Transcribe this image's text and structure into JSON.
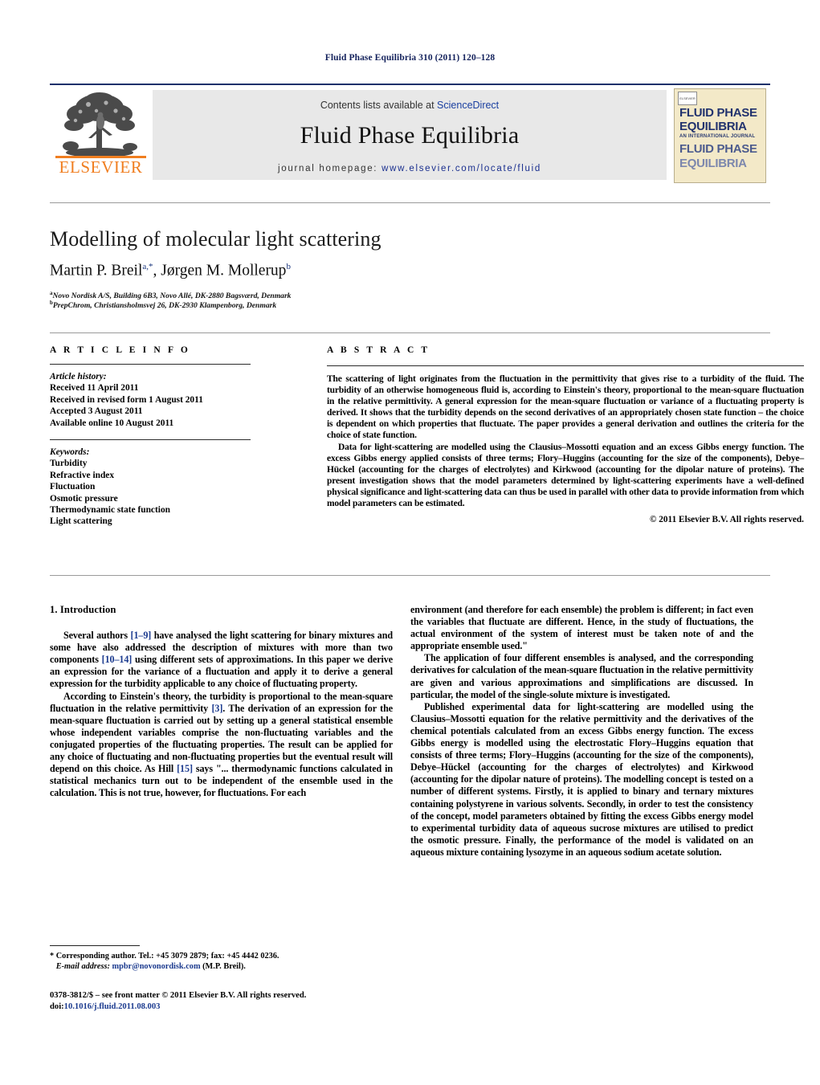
{
  "running_head": "Fluid Phase Equilibria 310 (2011) 120–128",
  "header": {
    "publisher_name": "ELSEVIER",
    "publisher_logo_alt": "elsevier-tree-logo",
    "contents_prefix": "Contents lists available at ",
    "contents_link": "ScienceDirect",
    "journal_title": "Fluid Phase Equilibria",
    "homepage_prefix": "journal homepage: ",
    "homepage_url": "www.elsevier.com/locate/fluid",
    "cover": {
      "badge": "ELSEVIER",
      "line1": "FLUID PHASE",
      "line2": "EQUILIBRIA",
      "line3": "AN INTERNATIONAL JOURNAL",
      "line4": "FLUID PHASE",
      "line5": "EQUILIBRIA"
    }
  },
  "article": {
    "title": "Modelling of molecular light scattering",
    "authors_html": "Martin P. Breil<sup>a,*</sup>, Jørgen M. Mollerup<sup>b</sup>",
    "affiliation_a_marker": "a",
    "affiliation_a": "Novo Nordisk A/S, Building 6B3, Novo Allé, DK-2880 Bagsværd, Denmark",
    "affiliation_b_marker": "b",
    "affiliation_b": "PrepChrom, Christiansholmsvej 26, DK-2930 Klampenborg, Denmark"
  },
  "article_info": {
    "heading": "A R T I C L E  I N F O",
    "history_heading": "Article history:",
    "history": [
      "Received 11 April 2011",
      "Received in revised form 1 August 2011",
      "Accepted 3 August 2011",
      "Available online 10 August 2011"
    ],
    "keywords_heading": "Keywords:",
    "keywords": [
      "Turbidity",
      "Refractive index",
      "Fluctuation",
      "Osmotic pressure",
      "Thermodynamic state function",
      "Light scattering"
    ]
  },
  "abstract": {
    "heading": "A B S T R A C T",
    "paragraphs": [
      "The scattering of light originates from the fluctuation in the permittivity that gives rise to a turbidity of the fluid. The turbidity of an otherwise homogeneous fluid is, according to Einstein's theory, proportional to the mean-square fluctuation in the relative permittivity. A general expression for the mean-square fluctuation or variance of a fluctuating property is derived. It shows that the turbidity depends on the second derivatives of an appropriately chosen state function – the choice is dependent on which properties that fluctuate. The paper provides a general derivation and outlines the criteria for the choice of state function.",
      "Data for light-scattering are modelled using the Clausius–Mossotti equation and an excess Gibbs energy function. The excess Gibbs energy applied consists of three terms; Flory–Huggins (accounting for the size of the components), Debye–Hückel (accounting for the charges of electrolytes) and Kirkwood (accounting for the dipolar nature of proteins). The present investigation shows that the model parameters determined by light-scattering experiments have a well-defined physical significance and light-scattering data can thus be used in parallel with other data to provide information from which model parameters can be estimated."
    ],
    "copyright": "© 2011 Elsevier B.V. All rights reserved."
  },
  "body": {
    "section_number_title": "1. Introduction",
    "left_paragraphs": [
      "Several authors [1–9] have analysed the light scattering for binary mixtures and some have also addressed the description of mixtures with more than two components [10–14] using different sets of approximations. In this paper we derive an expression for the variance of a fluctuation and apply it to derive a general expression for the turbidity applicable to any choice of fluctuating property.",
      "According to Einstein's theory, the turbidity is proportional to the mean-square fluctuation in the relative permittivity [3]. The derivation of an expression for the mean-square fluctuation is carried out by setting up a general statistical ensemble whose independent variables comprise the non-fluctuating variables and the conjugated properties of the fluctuating properties. The result can be applied for any choice of fluctuating and non-fluctuating properties but the eventual result will depend on this choice. As Hill [15] says \"... thermodynamic functions calculated in statistical mechanics turn out to be independent of the ensemble used in the calculation. This is not true, however, for fluctuations. For each"
    ],
    "right_paragraphs": [
      "environment (and therefore for each ensemble) the problem is different; in fact even the variables that fluctuate are different. Hence, in the study of fluctuations, the actual environment of the system of interest must be taken note of and the appropriate ensemble used.\"",
      "The application of four different ensembles is analysed, and the corresponding derivatives for calculation of the mean-square fluctuation in the relative permittivity are given and various approximations and simplifications are discussed. In particular, the model of the single-solute mixture is investigated.",
      "Published experimental data for light-scattering are modelled using the Clausius–Mossotti equation for the relative permittivity and the derivatives of the chemical potentials calculated from an excess Gibbs energy function. The excess Gibbs energy is modelled using the electrostatic Flory–Huggins equation that consists of three terms; Flory–Huggins (accounting for the size of the components), Debye–Hückel (accounting for the charges of electrolytes) and Kirkwood (accounting for the dipolar nature of proteins). The modelling concept is tested on a number of different systems. Firstly, it is applied to binary and ternary mixtures containing polystyrene in various solvents. Secondly, in order to test the consistency of the concept, model parameters obtained by fitting the excess Gibbs energy model to experimental turbidity data of aqueous sucrose mixtures are utilised to predict the osmotic pressure. Finally, the performance of the model is validated on an aqueous mixture containing lysozyme in an aqueous sodium acetate solution."
    ],
    "citation_refs": [
      "[1–9]",
      "[10–14]",
      "[3]",
      "[15]"
    ]
  },
  "footer": {
    "corresponding_marker": "*",
    "corresponding_text": "Corresponding author. Tel.: +45 3079 2879; fax: +45 4442 0236.",
    "email_label": "E-mail address:",
    "email": "mpbr@novonordisk.com",
    "email_suffix": "(M.P. Breil).",
    "issn_line": "0378-3812/$ – see front matter © 2011 Elsevier B.V. All rights reserved.",
    "doi_label": "doi:",
    "doi": "10.1016/j.fluid.2011.08.003"
  },
  "colors": {
    "link_blue": "#1c3b8f",
    "running_head_blue": "#14225c",
    "elsevier_orange": "#f07e20",
    "masthead_gray": "#e8e8e8",
    "cover_cream": "#f3e9c8"
  }
}
